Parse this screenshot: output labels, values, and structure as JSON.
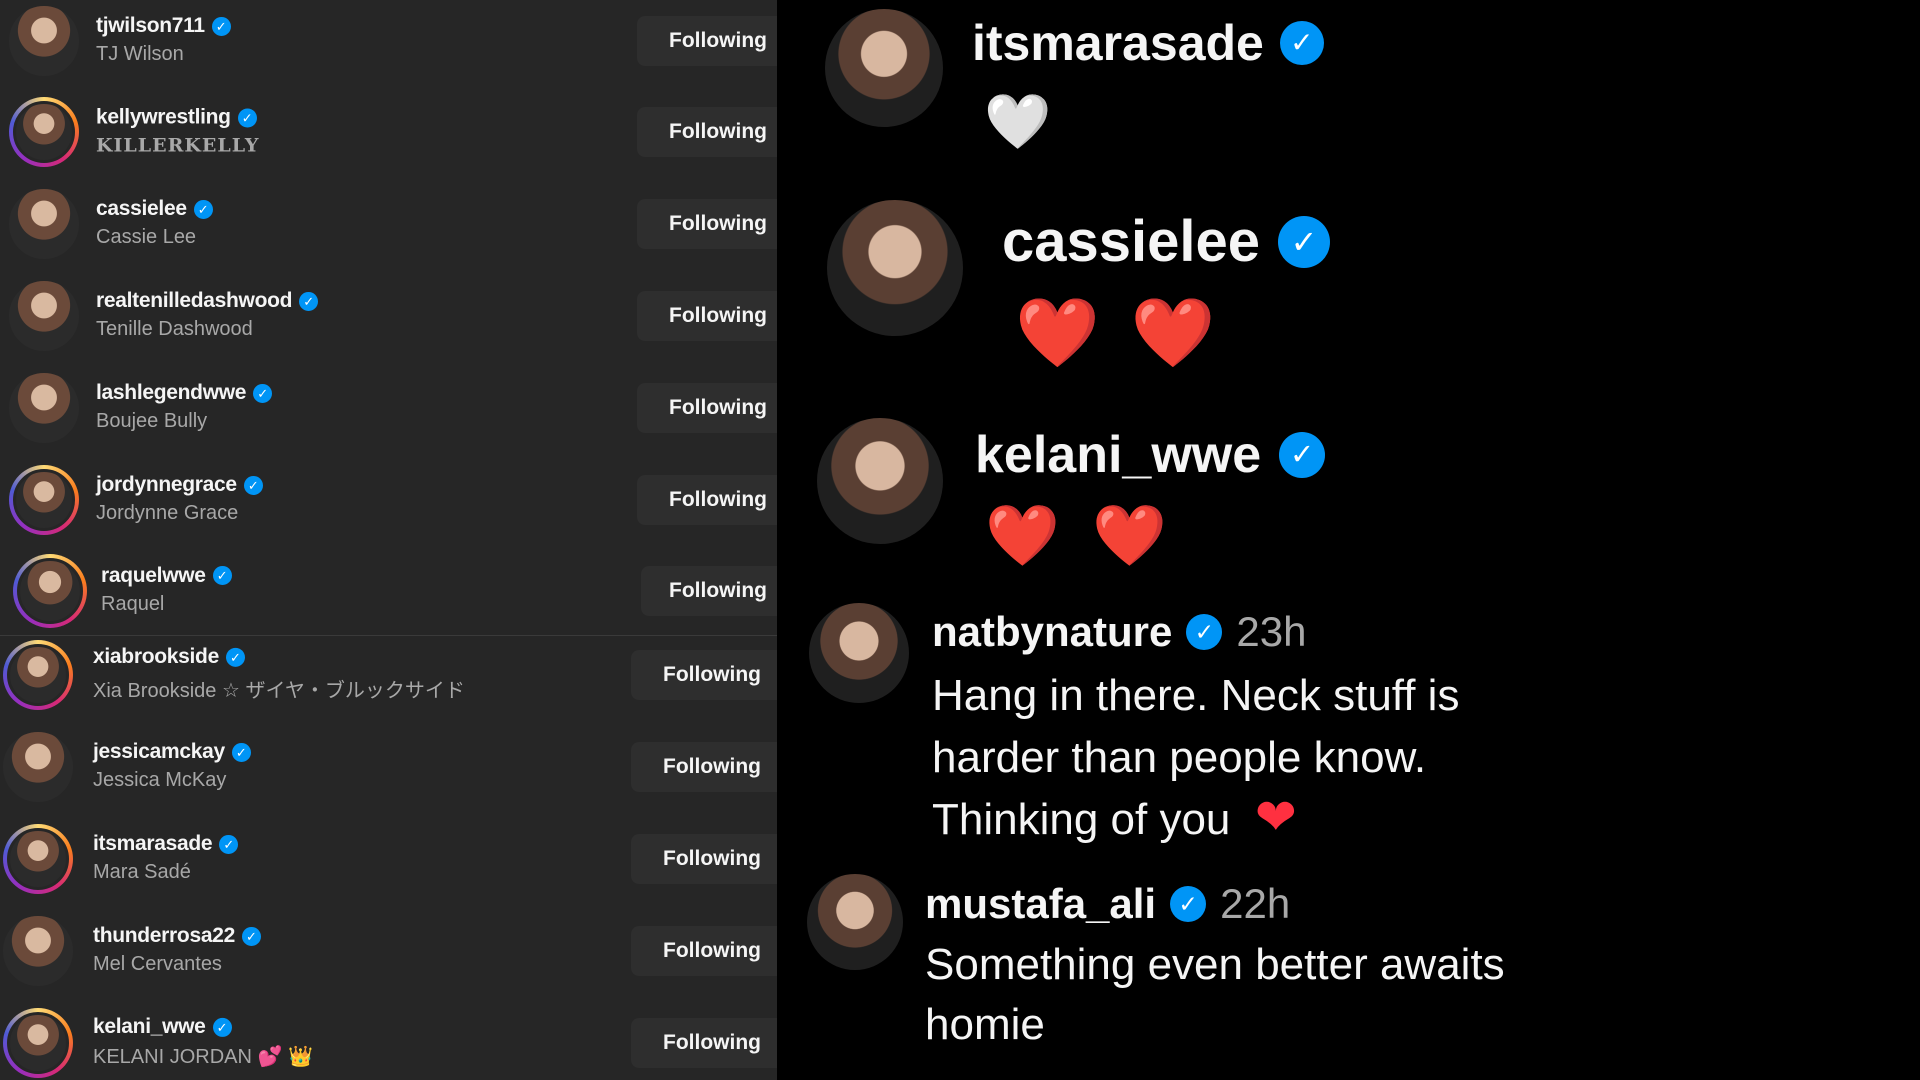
{
  "following_list": [
    {
      "handle": "tjwilson711",
      "name": "TJ Wilson",
      "button": "Following",
      "ring": false
    },
    {
      "handle": "kellywrestling",
      "name": "KILLERKELLY",
      "button": "Following",
      "ring": true
    },
    {
      "handle": "cassielee",
      "name": "Cassie Lee",
      "button": "Following",
      "ring": false
    },
    {
      "handle": "realtenilledashwood",
      "name": "Tenille Dashwood",
      "button": "Following",
      "ring": false
    },
    {
      "handle": "lashlegendwwe",
      "name": "Boujee Bully",
      "button": "Following",
      "ring": false
    },
    {
      "handle": "jordynnegrace",
      "name": "Jordynne Grace",
      "button": "Following",
      "ring": true
    },
    {
      "handle": "raquelwwe",
      "name": "Raquel",
      "button": "Following",
      "ring": true
    },
    {
      "handle": "xiabrookside",
      "name": "Xia Brookside ☆ ザイヤ・ブルックサイド",
      "button": "Following",
      "ring": true
    },
    {
      "handle": "jessicamckay",
      "name": "Jessica McKay",
      "button": "Following",
      "ring": false
    },
    {
      "handle": "itsmarasade",
      "name": "Mara Sadé",
      "button": "Following",
      "ring": true
    },
    {
      "handle": "thunderrosa22",
      "name": "Mel Cervantes",
      "button": "Following",
      "ring": false
    },
    {
      "handle": "kelani_wwe",
      "name": "KELANI JORDAN",
      "name_emoji_1": "💕",
      "name_emoji_2": "👑",
      "button": "Following",
      "ring": true
    }
  ],
  "comments": [
    {
      "username": "itsmarasade",
      "text": "🤍"
    },
    {
      "username": "cassielee",
      "text": "❤️ ❤️"
    },
    {
      "username": "kelani_wwe",
      "text": "❤️ ❤️"
    },
    {
      "username": "natbynature",
      "time": "23h",
      "line1": "Hang in there. Neck stuff is",
      "line2": "harder than people know.",
      "line3": "Thinking of you",
      "heart": "❤"
    },
    {
      "username": "mustafa_ali",
      "time": "22h",
      "line1": "Something even better awaits",
      "line2": "homie"
    }
  ],
  "icons": {
    "verified_badge": "verified-badge-icon",
    "badge_glyph": "✓"
  },
  "colors": {
    "left_bg": "#262626",
    "right_bg": "#000000",
    "verified": "#0095f6",
    "heart": "#ff3040",
    "muted_text": "#a8a8a8"
  }
}
